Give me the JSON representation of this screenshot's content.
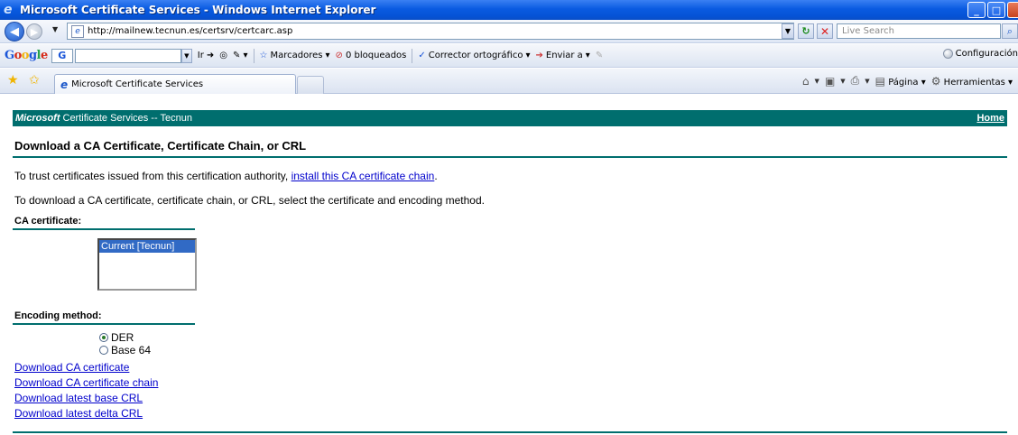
{
  "window": {
    "title": "Microsoft Certificate Services - Windows Internet Explorer",
    "controls": [
      "_",
      "□",
      "×"
    ]
  },
  "addressbar": {
    "url": "http://mailnew.tecnun.es/certsrv/certcarc.asp",
    "search_placeholder": "Live Search"
  },
  "googlebar": {
    "logo": [
      "G",
      "o",
      "o",
      "g",
      "l",
      "e"
    ],
    "g_button": "G",
    "go_label": "Ir",
    "bookmarks_label": "Marcadores",
    "blocked_label": "0 bloqueados",
    "spell_label": "Corrector ortográfico",
    "send_label": "Enviar a",
    "settings_label": "Configuración"
  },
  "tabs": {
    "active_label": "Microsoft Certificate Services"
  },
  "commandbar": {
    "page_label": "Página",
    "tools_label": "Herramientas"
  },
  "page": {
    "header": {
      "brand": "Microsoft",
      "title": "Certificate Services  --  Tecnun",
      "home": "Home"
    },
    "heading": "Download a CA Certificate, Certificate Chain, or CRL",
    "trust_text": "To trust certificates issued from this certification authority, ",
    "trust_link": "install this CA certificate chain",
    "trust_end": ".",
    "download_text": "To download a CA certificate, certificate chain, or CRL, select the certificate and encoding method.",
    "ca_label": "CA certificate:",
    "ca_options": [
      "Current [Tecnun]"
    ],
    "encoding_label": "Encoding method:",
    "encodings": [
      {
        "label": "DER",
        "selected": true
      },
      {
        "label": "Base 64",
        "selected": false
      }
    ],
    "links": [
      "Download CA certificate",
      "Download CA certificate chain",
      "Download latest base CRL",
      "Download latest delta CRL"
    ]
  },
  "colors": {
    "teal": "#006e6e",
    "link": "#0000cc",
    "selection": "#316ac5"
  }
}
